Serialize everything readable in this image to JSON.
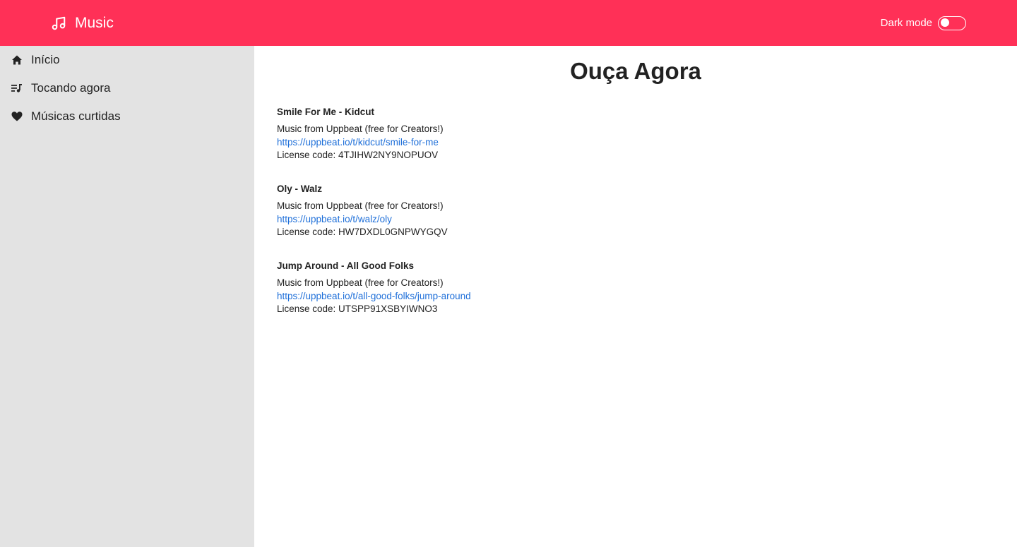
{
  "header": {
    "title": "Music",
    "dark_mode_label": "Dark mode",
    "dark_mode_enabled": false
  },
  "sidebar": {
    "items": [
      {
        "label": "Início",
        "icon": "home-icon"
      },
      {
        "label": "Tocando agora",
        "icon": "playlist-icon"
      },
      {
        "label": "Músicas curtidas",
        "icon": "heart-icon"
      }
    ]
  },
  "main": {
    "title": "Ouça Agora",
    "tracks": [
      {
        "title": "Smile For Me - Kidcut",
        "credit": "Music from Uppbeat (free for Creators!)",
        "link": "https://uppbeat.io/t/kidcut/smile-for-me",
        "license": "License code: 4TJIHW2NY9NOPUOV"
      },
      {
        "title": "Oly - Walz",
        "credit": "Music from Uppbeat (free for Creators!)",
        "link": "https://uppbeat.io/t/walz/oly",
        "license": "License code: HW7DXDL0GNPWYGQV"
      },
      {
        "title": "Jump Around - All Good Folks",
        "credit": "Music from Uppbeat (free for Creators!)",
        "link": "https://uppbeat.io/t/all-good-folks/jump-around",
        "license": "License code: UTSPP91XSBYIWNO3"
      }
    ]
  },
  "colors": {
    "accent": "#ff3057",
    "sidebar_bg": "#e3e3e3",
    "link": "#1e6fd9"
  }
}
